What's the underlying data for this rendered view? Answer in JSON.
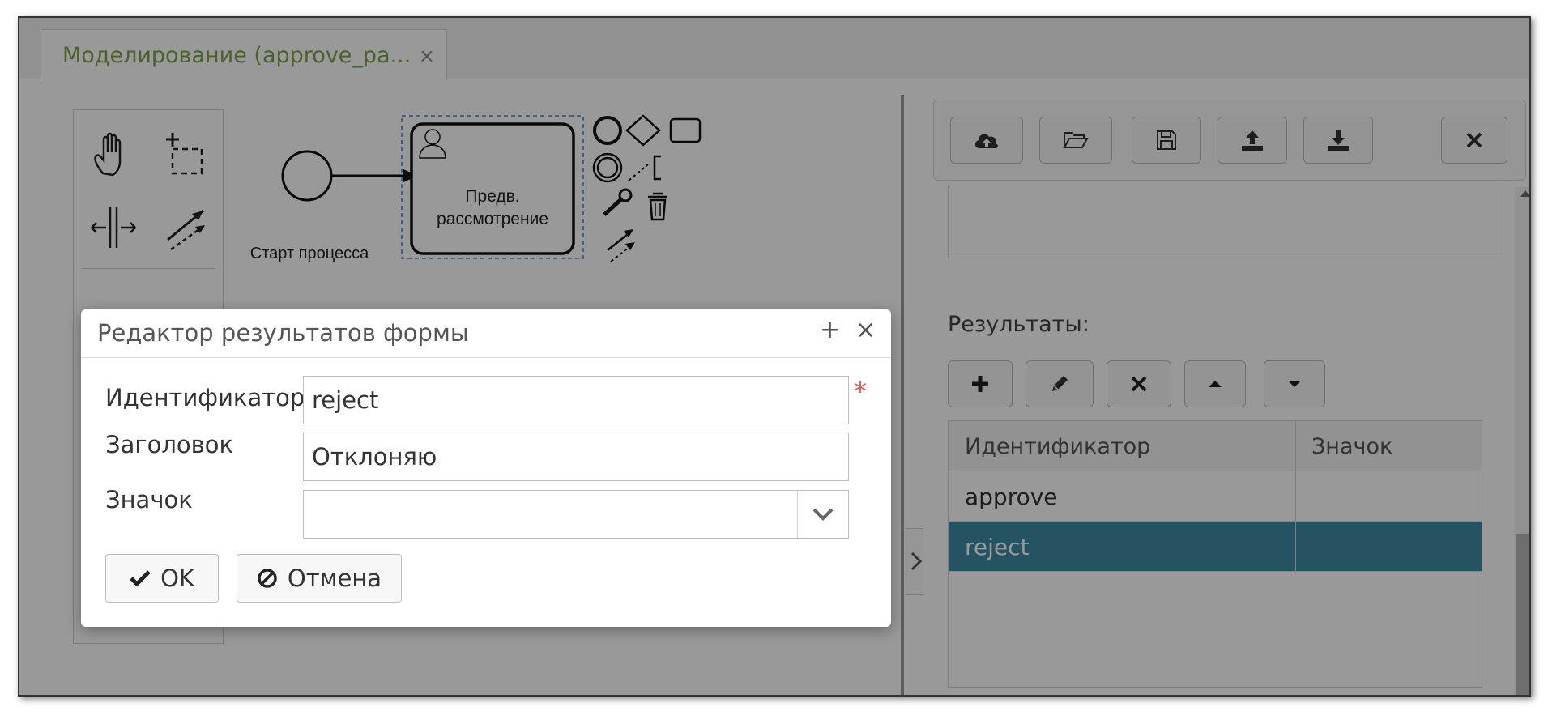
{
  "tab": {
    "title": "Моделирование (approve_pa...",
    "close_glyph": "×"
  },
  "diagram": {
    "start_event_label": "Старт процесса",
    "task_label_line1": "Предв.",
    "task_label_line2": "рассмотрение"
  },
  "panel": {
    "toolbar_icons": [
      "cloud-upload-icon",
      "folder-open-icon",
      "save-icon",
      "upload-icon",
      "download-icon",
      "close-icon"
    ],
    "results_label": "Результаты:",
    "results_toolbar_icons": [
      "plus-icon",
      "pencil-icon",
      "close-icon",
      "caret-up-icon",
      "caret-down-icon"
    ],
    "grid": {
      "columns": [
        "Идентификатор",
        "Значок"
      ],
      "rows": [
        {
          "id": "approve",
          "icon": ""
        },
        {
          "id": "reject",
          "icon": ""
        }
      ],
      "selected_row_index": 1,
      "selected_color": "#3e8aa3"
    }
  },
  "dialog": {
    "title": "Редактор результатов формы",
    "maximize_glyph": "+",
    "close_glyph": "×",
    "fields": {
      "identifier_label": "Идентификатор",
      "identifier_value": "reject",
      "required_mark": "*",
      "title_label": "Заголовок",
      "title_value": "Отклоняю",
      "icon_label": "Значок",
      "icon_value": ""
    },
    "ok_label": "OK",
    "cancel_label": "Отмена"
  },
  "colors": {
    "tab_text": "#7da14c",
    "required": "#d9534f",
    "overlay": "rgba(0,0,0,0.40)"
  }
}
